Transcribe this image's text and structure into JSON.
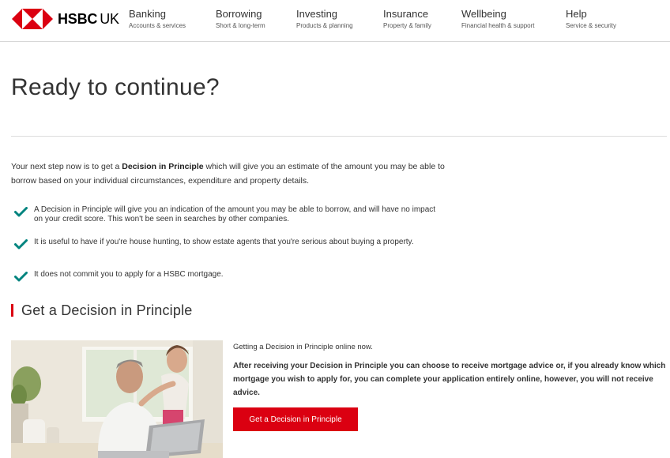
{
  "header": {
    "brand": {
      "name": "HSBC",
      "region": "UK"
    },
    "nav": [
      {
        "title": "Banking",
        "subtitle": "Accounts & services"
      },
      {
        "title": "Borrowing",
        "subtitle": "Short & long-term"
      },
      {
        "title": "Investing",
        "subtitle": "Products & planning"
      },
      {
        "title": "Insurance",
        "subtitle": "Property & family"
      },
      {
        "title": "Wellbeing",
        "subtitle": "Financial health & support"
      },
      {
        "title": "Help",
        "subtitle": "Service & security"
      }
    ]
  },
  "main": {
    "title": "Ready to continue?",
    "intro": {
      "before": "Your next step now is to get a ",
      "bold": "Decision in Principle",
      "after": " which will give you an estimate of the amount you may be able to borrow based on your individual circumstances, expenditure and property details."
    },
    "benefits": [
      "A Decision in Principle will give you an indication of the amount you may be able to borrow, and will have no impact on your credit score. This won't be seen in searches by other companies.",
      "It is useful to have if you're house hunting, to show estate agents that you're serious about buying a property.",
      "It does not commit you to apply for a HSBC mortgage."
    ],
    "section_title": "Get a Decision in Principle",
    "cta": {
      "subtitle": "Getting a Decision in Principle online now.",
      "body": "After receiving your Decision in Principle you can choose to receive mortgage advice or, if you already know which mortgage you wish to apply for, you can complete your application entirely online, however, you will not receive advice.",
      "button_label": "Get a Decision in Principle"
    }
  },
  "icons": {
    "benefit": "checkmark-icon",
    "brand": "hsbc-hexagon-logo"
  },
  "colors": {
    "brand_red": "#db0011",
    "check_teal": "#00847f",
    "text": "#333333"
  }
}
